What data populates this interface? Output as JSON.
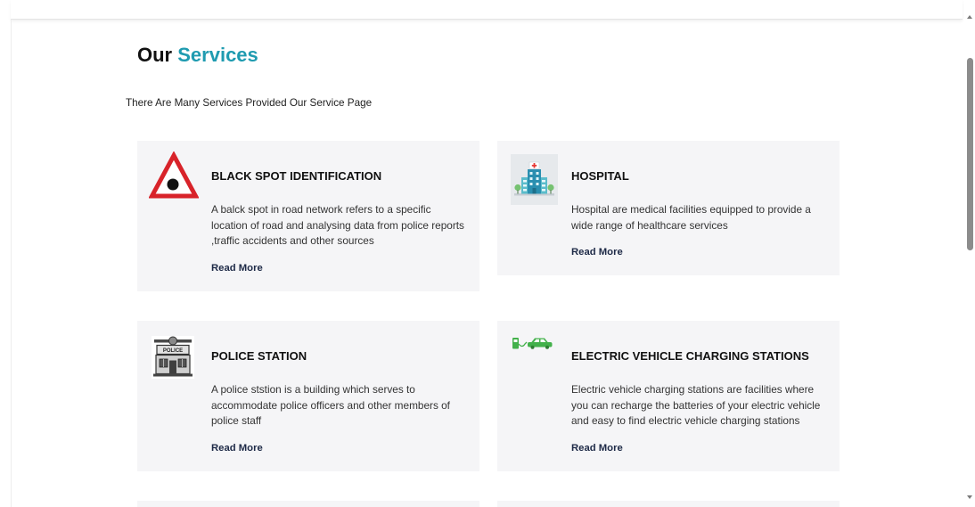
{
  "colors": {
    "accent": "#1f9bb0",
    "card_background": "#f5f5f7",
    "link": "#1e2a47",
    "warning_red": "#d8232a"
  },
  "section": {
    "heading_part1": "Our",
    "heading_part2": "Services",
    "subtitle": "There Are Many Services Provided Our Service Page"
  },
  "services": [
    {
      "icon": "warning-triangle-icon",
      "title": "BLACK SPOT IDENTIFICATION",
      "description_lines": [
        "A balck spot in road network refers to a specific",
        "location of road and analysing data from police reports",
        ",traffic accidents and other sources"
      ],
      "link_label": "Read More"
    },
    {
      "icon": "hospital-icon",
      "title": "HOSPITAL",
      "description_lines": [
        "Hospital are medical facilities equipped to provide a",
        "wide range of healthcare services"
      ],
      "link_label": "Read More"
    },
    {
      "icon": "police-station-icon",
      "icon_label": "POLICE",
      "title": "POLICE STATION",
      "description_lines": [
        "A police ststion is a building which serves to",
        "accommodate police officers and other members of",
        "police staff"
      ],
      "link_label": "Read More"
    },
    {
      "icon": "ev-charging-icon",
      "title": "ELECTRIC VEHICLE CHARGING STATIONS",
      "description_lines": [
        "Electric vehicle charging stations are facilities where",
        "you can recharge the batteries of your electric vehicle",
        "and easy to find electric vehicle charging stations"
      ],
      "link_label": "Read More"
    }
  ]
}
